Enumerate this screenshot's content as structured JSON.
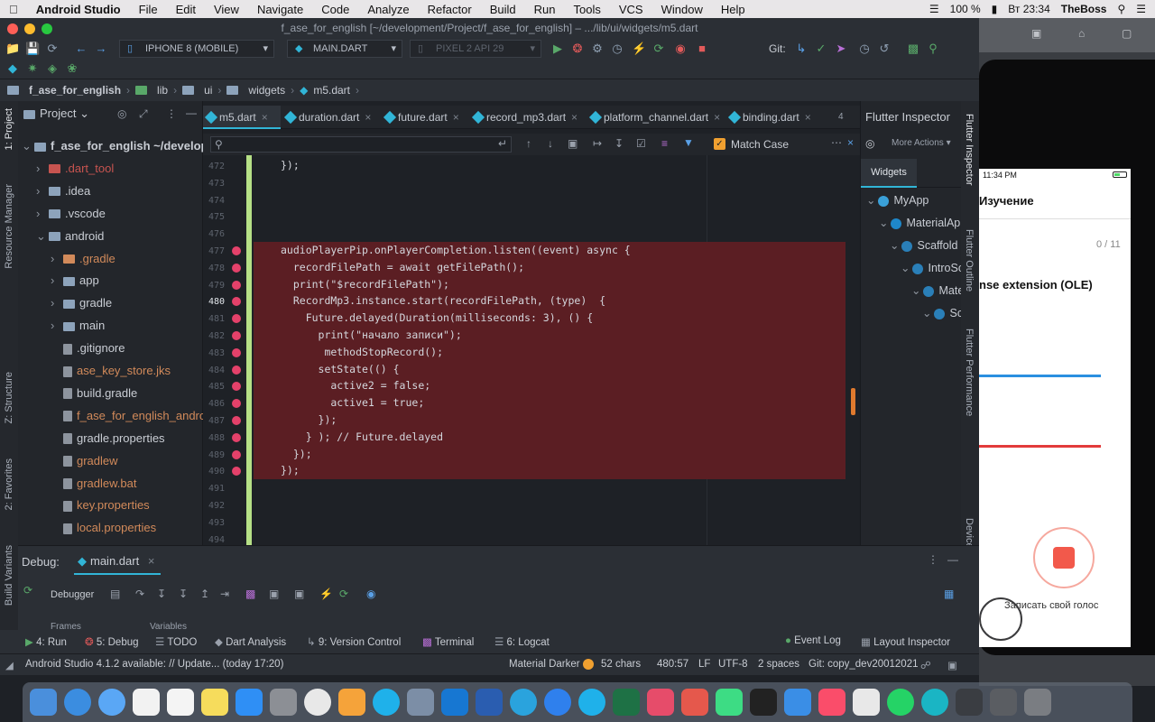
{
  "menubar": {
    "app": "Android Studio",
    "items": [
      "File",
      "Edit",
      "View",
      "Navigate",
      "Code",
      "Analyze",
      "Refactor",
      "Build",
      "Run",
      "Tools",
      "VCS",
      "Window",
      "Help"
    ],
    "battery": "100 %",
    "clock": "Вт 23:34",
    "user": "TheBoss"
  },
  "window": {
    "title": "f_ase_for_english [~/development/Project/f_ase_for_english] – .../lib/ui/widgets/m5.dart"
  },
  "toolbar": {
    "device": "IPHONE 8 (MOBILE)",
    "config": "MAIN.DART",
    "emulator": "PIXEL 2 API 29",
    "git_label": "Git:"
  },
  "breadcrumb": [
    "f_ase_for_english",
    "lib",
    "ui",
    "widgets",
    "m5.dart"
  ],
  "project_panel": {
    "title": "Project",
    "items": [
      {
        "label": "f_ase_for_english ~/develop",
        "type": "folder",
        "indent": 0,
        "open": true
      },
      {
        "label": ".dart_tool",
        "type": "folder",
        "indent": 1,
        "color": "#c75450"
      },
      {
        "label": ".idea",
        "type": "folder",
        "indent": 1
      },
      {
        "label": ".vscode",
        "type": "folder",
        "indent": 1
      },
      {
        "label": "android",
        "type": "folder",
        "indent": 1,
        "open": true
      },
      {
        "label": ".gradle",
        "type": "folder",
        "indent": 2,
        "color": "#d28a5a"
      },
      {
        "label": "app",
        "type": "folder",
        "indent": 2
      },
      {
        "label": "gradle",
        "type": "folder",
        "indent": 2
      },
      {
        "label": "main",
        "type": "folder",
        "indent": 2
      },
      {
        "label": ".gitignore",
        "type": "file",
        "indent": 2
      },
      {
        "label": "ase_key_store.jks",
        "type": "file",
        "indent": 2,
        "color": "#d28a5a"
      },
      {
        "label": "build.gradle",
        "type": "file",
        "indent": 2
      },
      {
        "label": "f_ase_for_english_androi",
        "type": "file",
        "indent": 2,
        "color": "#d28a5a"
      },
      {
        "label": "gradle.properties",
        "type": "file",
        "indent": 2
      },
      {
        "label": "gradlew",
        "type": "file",
        "indent": 2,
        "color": "#d28a5a"
      },
      {
        "label": "gradlew.bat",
        "type": "file",
        "indent": 2,
        "color": "#d28a5a"
      },
      {
        "label": "key.properties",
        "type": "file",
        "indent": 2,
        "color": "#d28a5a"
      },
      {
        "label": "local.properties",
        "type": "file",
        "indent": 2,
        "color": "#d28a5a"
      }
    ]
  },
  "tabs": [
    "m5.dart",
    "duration.dart",
    "future.dart",
    "record_mp3.dart",
    "platform_channel.dart",
    "binding.dart"
  ],
  "tabs_more": "4",
  "search": {
    "match_case": "Match Case",
    "value": ""
  },
  "editor": {
    "lines": [
      {
        "n": "472",
        "code": "});"
      },
      {
        "n": "473",
        "code": ""
      },
      {
        "n": "474",
        "code": ""
      },
      {
        "n": "475",
        "code": ""
      },
      {
        "n": "476",
        "code": ""
      },
      {
        "n": "477",
        "code": "audioPlayerPip.onPlayerCompletion.listen((event) async {",
        "bp": true
      },
      {
        "n": "478",
        "code": "  recordFilePath = await getFilePath();",
        "bp": true
      },
      {
        "n": "479",
        "code": "  print(\"$recordFilePath\");",
        "bp": true
      },
      {
        "n": "480",
        "code": "  RecordMp3.instance.start(recordFilePath, (type)  {",
        "bp": true
      },
      {
        "n": "481",
        "code": "    Future.delayed(Duration(milliseconds: 3), () {",
        "bp": true
      },
      {
        "n": "482",
        "code": "      print(\"начало записи\");",
        "bp": true
      },
      {
        "n": "483",
        "code": "       methodStopRecord();",
        "bp": true
      },
      {
        "n": "484",
        "code": "      setState(() {",
        "bp": true
      },
      {
        "n": "485",
        "code": "        active2 = false;",
        "bp": true
      },
      {
        "n": "486",
        "code": "        active1 = true;",
        "bp": true
      },
      {
        "n": "487",
        "code": "      });",
        "bp": true
      },
      {
        "n": "488",
        "code": "    } ); // Future.delayed",
        "bp": true
      },
      {
        "n": "489",
        "code": "  });",
        "bp": true
      },
      {
        "n": "490",
        "code": "});",
        "bp": true
      },
      {
        "n": "491",
        "code": ""
      },
      {
        "n": "492",
        "code": ""
      },
      {
        "n": "493",
        "code": ""
      },
      {
        "n": "494",
        "code": ""
      }
    ]
  },
  "inspector": {
    "title": "Flutter Inspector",
    "more_actions": "More Actions",
    "tab": "Widgets",
    "nodes": [
      "MyApp",
      "MaterialAp",
      "Scaffold",
      "IntroSc",
      "Mate",
      "Sc"
    ]
  },
  "right_strip": [
    "Flutter Inspector",
    "Flutter Outline",
    "Flutter Performance",
    "Device File Explorer"
  ],
  "left_strip": [
    "1: Project",
    "Resource Manager",
    "Z: Structure",
    "2: Favorites",
    "Build Variants"
  ],
  "debug": {
    "label": "Debug:",
    "tab": "main.dart",
    "debugger": "Debugger",
    "frames": "Frames",
    "variables": "Variables"
  },
  "bottom_tools": [
    {
      "label": "4: Run"
    },
    {
      "label": "5: Debug"
    },
    {
      "label": "TODO"
    },
    {
      "label": "Dart Analysis"
    },
    {
      "label": "9: Version Control"
    },
    {
      "label": "Terminal"
    },
    {
      "label": "6: Logcat"
    },
    {
      "label": "Event Log"
    },
    {
      "label": "Layout Inspector"
    }
  ],
  "status": {
    "message": "Android Studio 4.1.2 available: // Update... (today 17:20)",
    "theme": "Material Darker",
    "chars": "52 chars",
    "pos": "480:57",
    "lf": "LF",
    "enc": "UTF-8",
    "indent": "2 spaces",
    "git": "Git: copy_dev20012021"
  },
  "phone": {
    "time": "11:34 PM",
    "header": "Изучение",
    "counter": "0 / 11",
    "heading": "nse extension (OLE)",
    "record_label": "Записать свой голос"
  },
  "colors": {
    "accent_teal": "#31b5d7",
    "breakpoint": "#e4416a",
    "exec_bg": "#5b1e23",
    "record_red": "#f2594b",
    "line_blue": "#2b8fe0",
    "line_red": "#e23b3b"
  }
}
